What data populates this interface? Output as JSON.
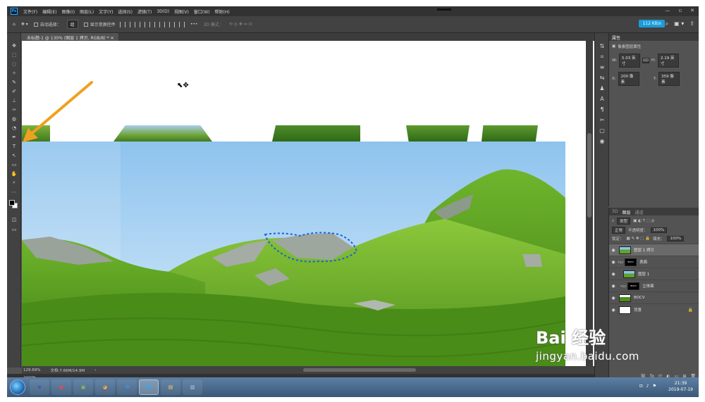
{
  "menu": [
    "文件(F)",
    "编辑(E)",
    "图像(I)",
    "图层(L)",
    "文字(Y)",
    "选择(S)",
    "滤镜(T)",
    "3D(D)",
    "视图(V)",
    "窗口(W)",
    "帮助(H)"
  ],
  "app_logo": "Ps",
  "window_controls": [
    "—",
    "▫",
    "✕"
  ],
  "options": {
    "auto_select_label": "自动选择：",
    "auto_select_value": "组",
    "show_transform_label": "显示变换控件",
    "mode_3d_label": "3D 模式：",
    "speed_badge": "112 KB/s"
  },
  "document_tab": "未标题-1 @ 130% (图层 1 拷贝, RGB/8) *",
  "tools": [
    "✥",
    "⬚",
    "◌",
    "✧",
    "✎",
    "✐",
    "⊥",
    "✑",
    "◍",
    "◔",
    "✒",
    "T",
    "↖",
    "▭",
    "✋",
    "⌕",
    "⋯"
  ],
  "status": {
    "zoom": "129.69%",
    "doc": "文档:7.66M/14.9M"
  },
  "timeline_label": "时间轴",
  "properties": {
    "tab": "属性",
    "title": "像素图层属性",
    "w_label": "W:",
    "w_value": "5.03 英寸",
    "h_label": "H:",
    "h_value": "2.19 英寸",
    "x_label": "X:",
    "x_value": "200 像素",
    "y_label": "Y:",
    "y_value": "359 像素",
    "link": "GO"
  },
  "layers_panel": {
    "tabs": [
      "3D",
      "图层",
      "通道"
    ],
    "active_tab": "图层",
    "filter": "类型",
    "blend_mode": "正常",
    "opacity_label": "不透明度：",
    "opacity_value": "100%",
    "lock_label": "锁定：",
    "fill_label": "填充：",
    "fill_value": "100%",
    "layers": [
      {
        "name": "图层 1 拷贝",
        "selected": true,
        "thumb": "photo"
      },
      {
        "name": "表面",
        "selected": false,
        "thumb": "mask"
      },
      {
        "name": "图层 1",
        "selected": false,
        "thumb": "photo"
      },
      {
        "name": "立体面",
        "selected": false,
        "thumb": "mask"
      },
      {
        "name": "BOCV",
        "selected": false,
        "thumb": "photo"
      },
      {
        "name": "背景",
        "selected": false,
        "thumb": "white",
        "locked": true
      }
    ],
    "mask_text": "BOCV"
  },
  "taskbar": {
    "apps": [
      "e",
      "◉",
      "▣",
      "◕",
      "⟲",
      "Ps",
      "▤",
      "▧"
    ],
    "active_app": "Ps",
    "time": "21:39",
    "date": "2019-07-19"
  },
  "watermark": {
    "brand": "Bai 经验",
    "url": "jingyan.baidu.com"
  },
  "colors": {
    "accent": "#f0a020",
    "ps_blue": "#31a8ff",
    "selection": "#1e5fd6"
  }
}
